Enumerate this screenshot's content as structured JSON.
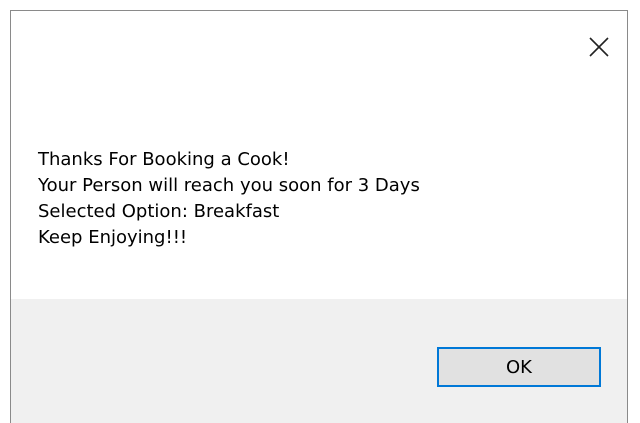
{
  "dialog": {
    "message_lines": [
      "Thanks For Booking a Cook!",
      "Your Person will reach you soon for 3 Days",
      "Selected Option: Breakfast",
      "Keep Enjoying!!!"
    ],
    "ok_label": "OK",
    "close_icon": "close-icon"
  },
  "colors": {
    "accent": "#0078d7",
    "footer_bg": "#f0f0f0",
    "button_bg": "#e1e1e1"
  }
}
